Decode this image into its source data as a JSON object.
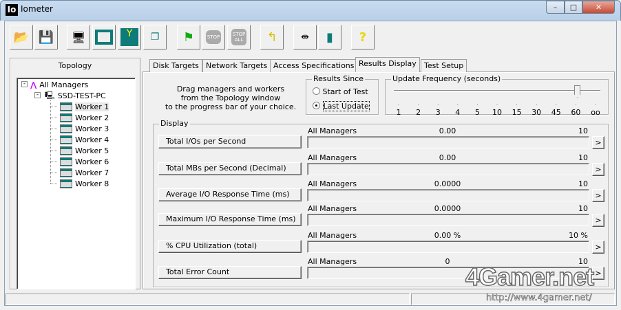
{
  "window": {
    "title": "Iometer",
    "app_icon": "Io",
    "minimize": "–",
    "maximize": "□",
    "close": "✕"
  },
  "toolbar": [
    "open-icon",
    "save-icon",
    "display-icon",
    "new-worker-icon",
    "network-worker-icon",
    "copy-worker-icon",
    "start-icon",
    "stop-icon",
    "stop-all-icon",
    "reset-icon",
    "disconnect-icon",
    "exit-icon",
    "help-icon"
  ],
  "topology": {
    "title": "Topology",
    "root": "All Managers",
    "manager": "SSD-TEST-PC",
    "workers": [
      "Worker 1",
      "Worker 2",
      "Worker 3",
      "Worker 4",
      "Worker 5",
      "Worker 6",
      "Worker 7",
      "Worker 8"
    ],
    "selected": "Worker 1"
  },
  "tabs": [
    {
      "label": "Disk Targets"
    },
    {
      "label": "Network Targets"
    },
    {
      "label": "Access Specifications"
    },
    {
      "label": "Results Display",
      "active": true
    },
    {
      "label": "Test Setup"
    }
  ],
  "results": {
    "hint": [
      "Drag managers and workers",
      "from the Topology window",
      "to the progress bar of your choice."
    ],
    "results_since": {
      "label": "Results Since",
      "options": [
        "Start of Test",
        "Last Update"
      ],
      "selected": "Last Update"
    },
    "update_frequency": {
      "label": "Update Frequency (seconds)",
      "ticks": [
        "1",
        "2",
        "3",
        "4",
        "5",
        "10",
        "15",
        "30",
        "45",
        "60",
        "oo"
      ],
      "value": "60"
    },
    "display_label": "Display",
    "rows": [
      {
        "button": "Total I/Os per Second",
        "source": "All Managers",
        "value": "0.00",
        "max": "10"
      },
      {
        "button": "Total MBs per Second (Decimal)",
        "source": "All Managers",
        "value": "0.00",
        "max": "10"
      },
      {
        "button": "Average I/O Response Time (ms)",
        "source": "All Managers",
        "value": "0.0000",
        "max": "10"
      },
      {
        "button": "Maximum I/O Response Time (ms)",
        "source": "All Managers",
        "value": "0.0000",
        "max": "10"
      },
      {
        "button": "% CPU Utilization (total)",
        "source": "All Managers",
        "value": "0.00 %",
        "max": "10 %"
      },
      {
        "button": "Total Error Count",
        "source": "All Managers",
        "value": "0",
        "max": "10"
      }
    ],
    "arrow": ">"
  },
  "watermark": {
    "logo": "4Gamer.net",
    "url": "http://www.4gamer.net/"
  }
}
